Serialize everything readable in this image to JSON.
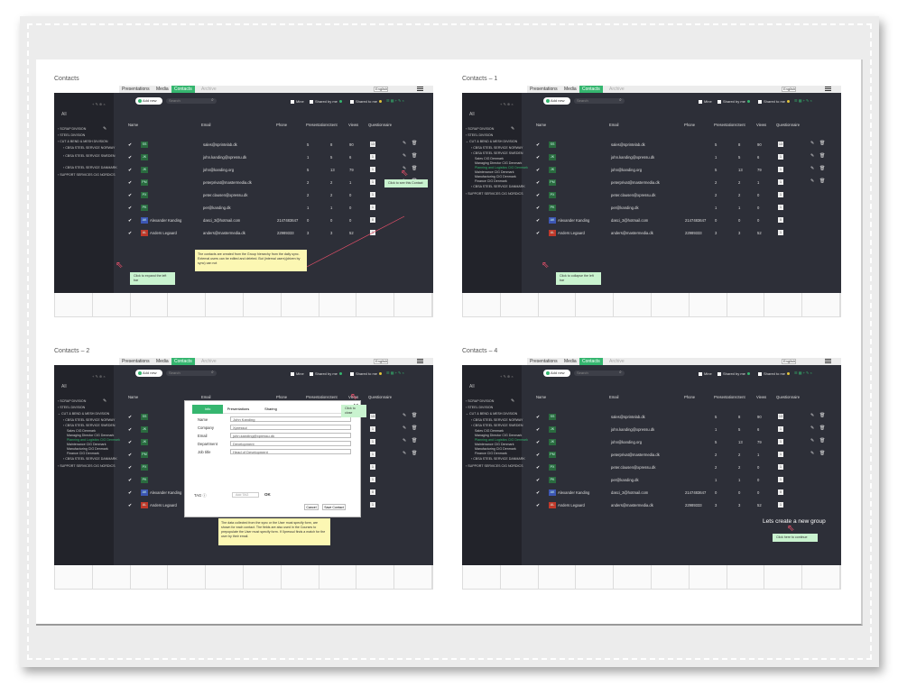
{
  "panels": [
    {
      "title": "Contacts"
    },
    {
      "title": "Contacts – 1"
    },
    {
      "title": "Contacts – 2"
    },
    {
      "title": "Contacts – 4"
    }
  ],
  "nav": {
    "presentations": "Presentations",
    "media": "Media",
    "contacts": "Contacts",
    "archive": "Archive",
    "language": "English"
  },
  "sidebar": {
    "all": "All",
    "groups": [
      "SCRAP DIVISION",
      "STEEL DIVISION",
      "CUT & BEND & MESH DIVISION",
      "CBSA STEEL SERVICE NORWAY",
      "CBSA STEEL SERVICE SWEDEN",
      "Sales CIG Denmark",
      "Managing Director CIG Denmark",
      "Planning and Logistics CIG Denmark",
      "Maintenance CIG Denmark",
      "Manufacturing CIG Denmark",
      "Finance CIG Denmark",
      "CBSA STEEL SERVICE DANMARK",
      "SUPPORT SERVICES CIG NORDICS"
    ]
  },
  "toolbar": {
    "add_new": "Add new",
    "search_placeholder": "Search",
    "mine": "Mine",
    "shared_by_me": "Shared by me",
    "shared_to_me": "Shared to me",
    "search_icon": "magnifier-icon"
  },
  "columns": {
    "name": "Name",
    "email": "Email",
    "phone": "Phone",
    "presentations": "Presentations",
    "sent": "Sent",
    "views": "Views",
    "questionnaire": "Questionnaire"
  },
  "contacts": [
    {
      "initials": "SS",
      "name": "",
      "email": "sales@sprintelab.dk",
      "phone": "",
      "presentations": "5",
      "sent": "8",
      "views": "90",
      "q": "13"
    },
    {
      "initials": "JK",
      "name": "",
      "email": "john.kanding@xpressu.dk",
      "phone": "",
      "presentations": "1",
      "sent": "5",
      "views": "6",
      "q": "1"
    },
    {
      "initials": "JK",
      "name": "",
      "email": "john@kanding.org",
      "phone": "",
      "presentations": "5",
      "sent": "13",
      "views": "79",
      "q": "1"
    },
    {
      "initials": "PM",
      "name": "",
      "email": "peterprivat@mastermedia.dk",
      "phone": "",
      "presentations": "2",
      "sent": "2",
      "views": "1",
      "q": "1"
    },
    {
      "initials": "PX",
      "name": "",
      "email": "peter.clausen@xpressu.dk",
      "phone": "",
      "presentations": "2",
      "sent": "2",
      "views": "0",
      "q": "1"
    },
    {
      "initials": "PK",
      "name": "",
      "email": "per@kanding.dk",
      "phone": "",
      "presentations": "1",
      "sent": "1",
      "views": "0",
      "q": "1"
    },
    {
      "initials": "AK",
      "name": "Alexander Kanding",
      "email": "dasci_3@hotmail.com",
      "phone": "2147483647",
      "presentations": "0",
      "sent": "0",
      "views": "0",
      "q": "0"
    },
    {
      "initials": "AL",
      "name": "Anders Legaard",
      "email": "anders@mastermedia.dk",
      "phone": "22989333",
      "presentations": "3",
      "sent": "3",
      "views": "52",
      "q": "1"
    }
  ],
  "notes": {
    "p1_note": "The contacts are created from the Group hierarchy from the daily sync. External users can be edited and deleted. But (internal users)(driven by sync) can not",
    "p1_expand": "Click to expand the left bar",
    "p1_see": "Click to see this Contact",
    "p2_collapse": "Click to collapse the left bar",
    "p3_note": "The data collected from the sync or the User must specify form, are shown for each contact. The fields are also used in the Courses to prepopulate the User must specify form. If Xpressul finds a match for the user by their email.",
    "p3_close": "Click to close",
    "p4_create": "Lets create a new group",
    "p4_continue": "Click here to continue"
  },
  "modal": {
    "tabs": [
      "Info",
      "Presentations",
      "Sharing"
    ],
    "labels": [
      "Name",
      "Company",
      "Email",
      "Department",
      "Job title"
    ],
    "values": [
      "John Kanding",
      "Xpressul",
      "john.kanding@xpressu.dk",
      "Development",
      "Head of Development"
    ],
    "tag_label": "TAG",
    "tag_placeholder": "Add TAG",
    "ok": "OK",
    "cancel": "Cancel",
    "save": "Save Contact"
  },
  "colors": {
    "accent": "#35b66f",
    "app_bg": "#2d2f38",
    "sidebar_bg": "#22232a",
    "note": "#fcf7b3",
    "tip": "#c9f3cf",
    "cursor": "#e8506a"
  }
}
